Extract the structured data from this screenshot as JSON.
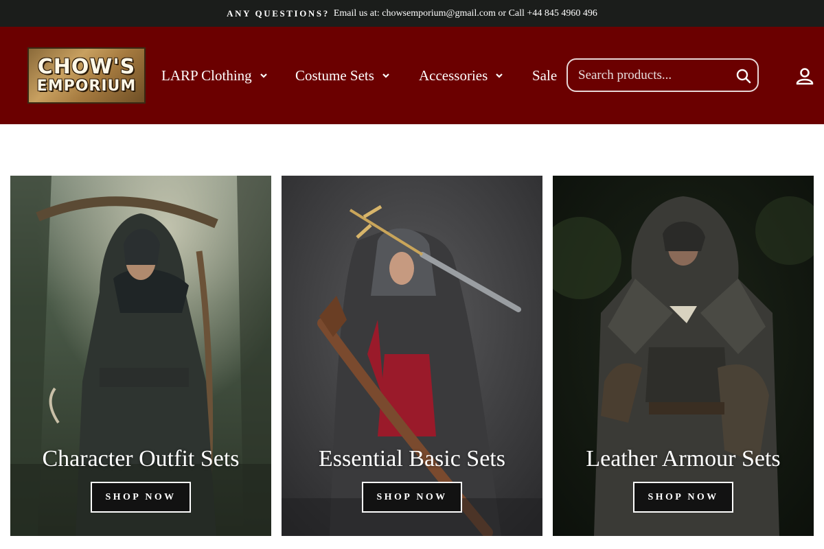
{
  "announcement": {
    "label": "ANY QUESTIONS?",
    "text": "Email us at: chowsemporium@gmail.com or Call +44 845 4960 496"
  },
  "logo": {
    "line1": "CHOW'S",
    "line2": "EMPORIUM"
  },
  "nav": {
    "items": [
      {
        "label": "LARP Clothing",
        "has_dropdown": true
      },
      {
        "label": "Costume Sets",
        "has_dropdown": true
      },
      {
        "label": "Accessories",
        "has_dropdown": true
      },
      {
        "label": "Sale",
        "has_dropdown": false
      }
    ]
  },
  "search": {
    "placeholder": "Search products..."
  },
  "icons": {
    "search": "search-icon",
    "account": "account-icon",
    "dropdown": "chevron-down-icon"
  },
  "colors": {
    "topbar": "#1b1d1b",
    "header": "#6b0000",
    "button_bg": "#121212",
    "text_light": "#ffffff"
  },
  "collections": [
    {
      "title": "Character Outfit Sets",
      "button": "SHOP NOW"
    },
    {
      "title": "Essential Basic Sets",
      "button": "SHOP NOW"
    },
    {
      "title": "Leather Armour Sets",
      "button": "SHOP NOW"
    }
  ]
}
